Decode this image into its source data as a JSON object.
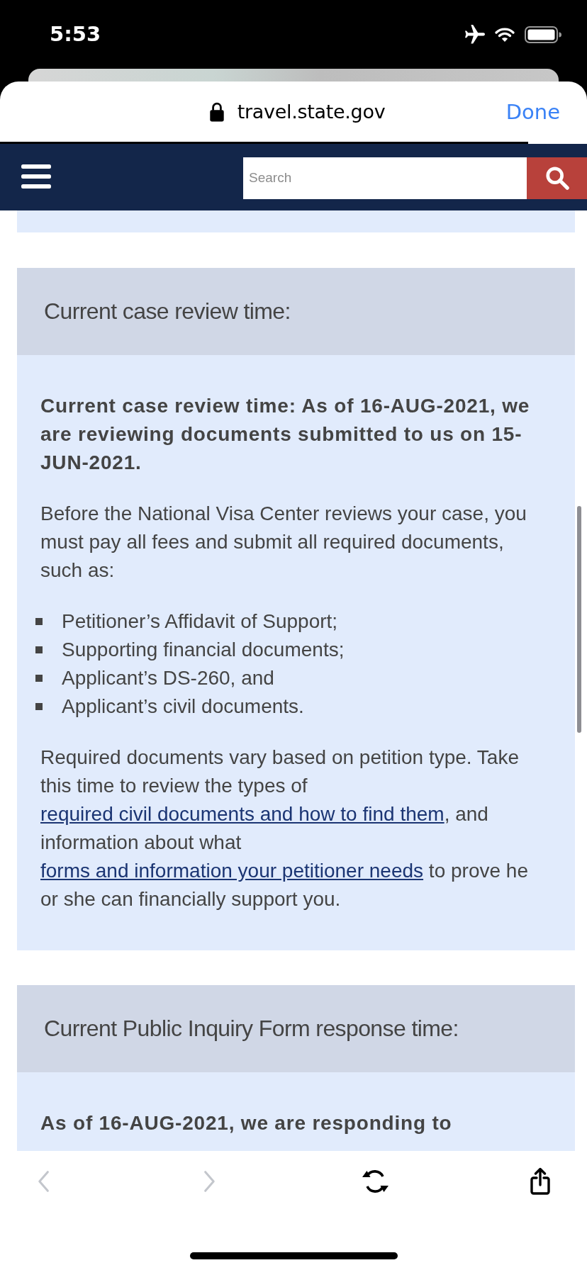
{
  "status_bar": {
    "time": "5:53"
  },
  "browser": {
    "url": "travel.state.gov",
    "done_label": "Done"
  },
  "site_header": {
    "search": {
      "placeholder": "Search"
    }
  },
  "sections": [
    {
      "title": "Current case review time:",
      "blocks": [
        {
          "kind": "lead",
          "text": "Current case review time: As of 16-AUG-2021, we are reviewing documents submitted to us on 15-JUN-2021."
        },
        {
          "kind": "paragraph",
          "parts": [
            {
              "kind": "text",
              "text": "Before the National Visa Center reviews your case, you must pay all fees and submit all required documents, such as:"
            }
          ]
        },
        {
          "kind": "list",
          "items": [
            "Petitioner’s Affidavit of Support;",
            "Supporting financial documents;",
            "Applicant’s DS-260, and",
            "Applicant’s civil documents."
          ]
        },
        {
          "kind": "paragraph",
          "parts": [
            {
              "kind": "text",
              "text": "Required documents vary based on petition type. Take this time to review the types of "
            },
            {
              "kind": "link",
              "text": "required civil documents and how to find them"
            },
            {
              "kind": "text",
              "text": ", and information about what "
            },
            {
              "kind": "link",
              "text": "forms and information your petitioner needs"
            },
            {
              "kind": "text",
              "text": " to prove he or she can financially support you."
            }
          ]
        }
      ]
    },
    {
      "title": "Current Public Inquiry Form response time:",
      "blocks": [
        {
          "kind": "lead",
          "text": "As of 16-AUG-2021, we are responding to"
        }
      ]
    }
  ],
  "toolbar": {
    "back": {
      "disabled": true
    },
    "forward": {
      "disabled": true
    }
  }
}
